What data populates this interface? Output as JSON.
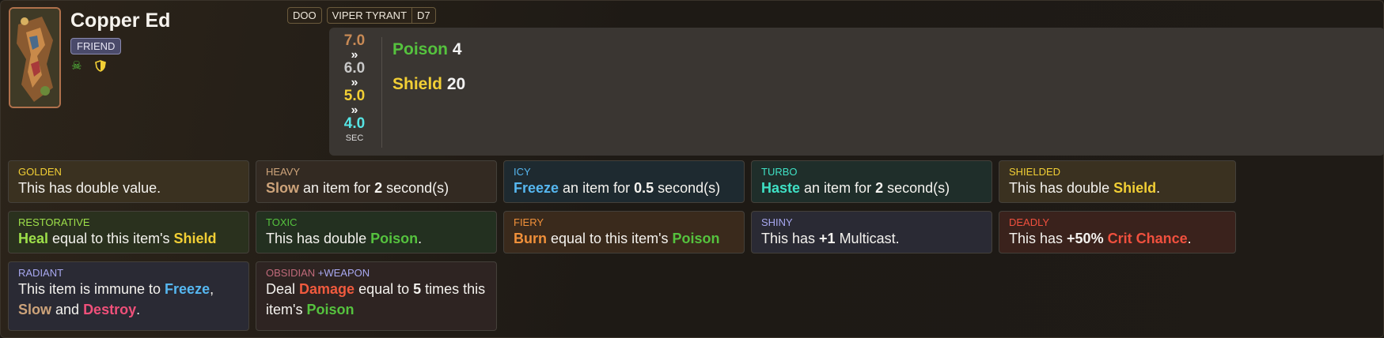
{
  "item": {
    "name": "Copper Ed",
    "badge": "FRIEND",
    "tag_icons": [
      {
        "icon": "skull-icon",
        "color": "#55c23e"
      },
      {
        "icon": "shield-icon",
        "color": "#f2cf35"
      }
    ]
  },
  "header_tags": {
    "owner": "DOO",
    "hero": "VIPER TYRANT",
    "tier": "D7"
  },
  "cooldown": {
    "steps": [
      {
        "value": "7.0",
        "color": "#c88a55"
      },
      {
        "value": "6.0",
        "color": "#c8c8c8"
      },
      {
        "value": "5.0",
        "color": "#f2cf35"
      },
      {
        "value": "4.0",
        "color": "#56e4e4"
      }
    ],
    "separator": "»",
    "unit": "SEC"
  },
  "effects": [
    {
      "keyword": "Poison",
      "value": "4"
    },
    {
      "keyword": "Shield",
      "value": "20"
    }
  ],
  "enchantments": [
    {
      "label": "GOLDEN",
      "label_color": "#f2cf35",
      "bg": "#3a3120",
      "parts": [
        [
          "This has double value.",
          ""
        ]
      ]
    },
    {
      "label": "HEAVY",
      "label_color": "#cda37a",
      "bg": "#332a22",
      "parts": [
        [
          "Slow",
          "slow"
        ],
        [
          " an item for ",
          ""
        ],
        [
          "2",
          "b"
        ],
        [
          " second(s)",
          ""
        ]
      ]
    },
    {
      "label": "ICY",
      "label_color": "#56b7f0",
      "bg": "#1e2a30",
      "parts": [
        [
          "Freeze",
          "freeze"
        ],
        [
          " an item for ",
          ""
        ],
        [
          "0.5",
          "b"
        ],
        [
          " second(s)",
          ""
        ]
      ]
    },
    {
      "label": "TURBO",
      "label_color": "#3fe0c4",
      "bg": "#1f2e2a",
      "parts": [
        [
          "Haste",
          "haste"
        ],
        [
          " an item for ",
          ""
        ],
        [
          "2",
          "b"
        ],
        [
          " second(s)",
          ""
        ]
      ]
    },
    {
      "label": "SHIELDED",
      "label_color": "#f2cf35",
      "bg": "#3a3120",
      "parts": [
        [
          "This has double ",
          ""
        ],
        [
          "Shield",
          "shield"
        ],
        [
          ".",
          ""
        ]
      ]
    },
    {
      "label": "RESTORATIVE",
      "label_color": "#9ee04a",
      "bg": "#2a311e",
      "parts": [
        [
          "Heal",
          "heal"
        ],
        [
          " equal to this item's ",
          ""
        ],
        [
          "Shield",
          "shield"
        ]
      ]
    },
    {
      "label": "TOXIC",
      "label_color": "#55c23e",
      "bg": "#233020",
      "parts": [
        [
          "This has double ",
          ""
        ],
        [
          "Poison",
          "poison"
        ],
        [
          ".",
          ""
        ]
      ]
    },
    {
      "label": "FIERY",
      "label_color": "#f0903a",
      "bg": "#3a2a1c",
      "parts": [
        [
          "Burn",
          "burn"
        ],
        [
          " equal to this item's ",
          ""
        ],
        [
          "Poison",
          "poison"
        ]
      ]
    },
    {
      "label": "SHINY",
      "label_color": "#a8a8f0",
      "bg": "#2a2a34",
      "parts": [
        [
          "This has ",
          ""
        ],
        [
          "+1",
          "b"
        ],
        [
          " Multicast.",
          ""
        ]
      ]
    },
    {
      "label": "DEADLY",
      "label_color": "#f0503e",
      "bg": "#3a221c",
      "parts": [
        [
          "This has ",
          ""
        ],
        [
          "+50%",
          "b"
        ],
        [
          " ",
          ""
        ],
        [
          "Crit Chance",
          "crit"
        ],
        [
          ".",
          ""
        ]
      ]
    },
    {
      "label": "RADIANT",
      "label_color": "#a8a8f0",
      "bg": "#2a2a34",
      "parts": [
        [
          "This item is immune to ",
          ""
        ],
        [
          "Freeze",
          "freeze"
        ],
        [
          ", ",
          ""
        ],
        [
          "Slow",
          "slow"
        ],
        [
          " and ",
          ""
        ],
        [
          "Destroy",
          "destroy"
        ],
        [
          ".",
          ""
        ]
      ]
    },
    {
      "label": "OBSIDIAN",
      "label_color": "#c06a7a",
      "label_extra": "+WEAPON",
      "label_extra_color": "#a8a8f0",
      "bg": "#2e2422",
      "parts": [
        [
          "Deal ",
          ""
        ],
        [
          "Damage",
          "damage"
        ],
        [
          " equal to ",
          ""
        ],
        [
          "5",
          "b"
        ],
        [
          " times this item's ",
          ""
        ],
        [
          "Poison",
          "poison"
        ]
      ]
    }
  ]
}
